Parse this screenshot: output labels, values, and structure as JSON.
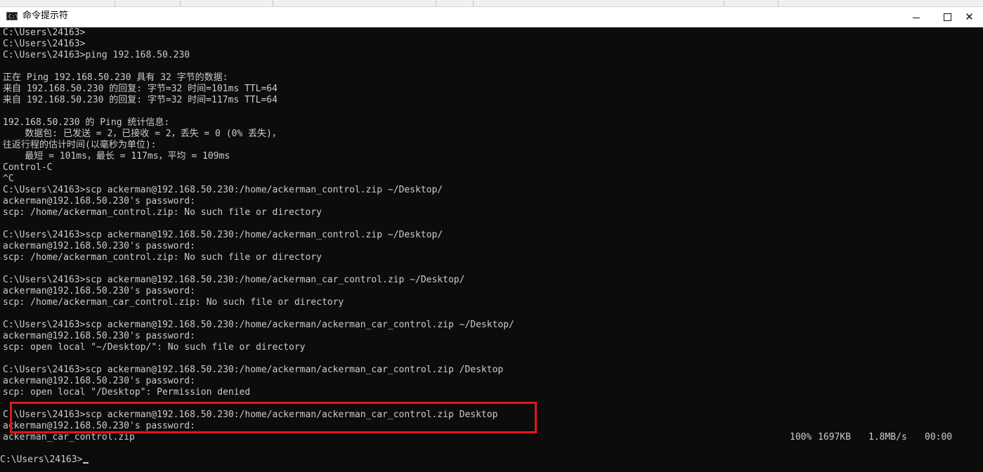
{
  "window": {
    "title": "命令提示符",
    "icon": "cmd-icon",
    "minimize_icon": "minimize-icon",
    "maximize_icon": "maximize-icon",
    "close_icon": "close-icon"
  },
  "terminal": {
    "background": "#0c0c0c",
    "foreground": "#cccccc",
    "lines": [
      "C:\\Users\\24163>",
      "C:\\Users\\24163>",
      "C:\\Users\\24163>ping 192.168.50.230",
      "",
      "正在 Ping 192.168.50.230 具有 32 字节的数据:",
      "来自 192.168.50.230 的回复: 字节=32 时间=101ms TTL=64",
      "来自 192.168.50.230 的回复: 字节=32 时间=117ms TTL=64",
      "",
      "192.168.50.230 的 Ping 统计信息:",
      "    数据包: 已发送 = 2，已接收 = 2，丢失 = 0 (0% 丢失)，",
      "往返行程的估计时间(以毫秒为单位):",
      "    最短 = 101ms，最长 = 117ms，平均 = 109ms",
      "Control-C",
      "^C",
      "C:\\Users\\24163>scp ackerman@192.168.50.230:/home/ackerman_control.zip ~/Desktop/",
      "ackerman@192.168.50.230's password:",
      "scp: /home/ackerman_control.zip: No such file or directory",
      "",
      "C:\\Users\\24163>scp ackerman@192.168.50.230:/home/ackerman_control.zip ~/Desktop/",
      "ackerman@192.168.50.230's password:",
      "scp: /home/ackerman_control.zip: No such file or directory",
      "",
      "C:\\Users\\24163>scp ackerman@192.168.50.230:/home/ackerman_car_control.zip ~/Desktop/",
      "ackerman@192.168.50.230's password:",
      "scp: /home/ackerman_car_control.zip: No such file or directory",
      "",
      "C:\\Users\\24163>scp ackerman@192.168.50.230:/home/ackerman/ackerman_car_control.zip ~/Desktop/",
      "ackerman@192.168.50.230's password:",
      "scp: open local \"~/Desktop/\": No such file or directory",
      "",
      "C:\\Users\\24163>scp ackerman@192.168.50.230:/home/ackerman/ackerman_car_control.zip /Desktop",
      "ackerman@192.168.50.230's password:",
      "scp: open local \"/Desktop\": Permission denied",
      "",
      "C:\\Users\\24163>scp ackerman@192.168.50.230:/home/ackerman/ackerman_car_control.zip Desktop",
      "ackerman@192.168.50.230's password:"
    ],
    "transfer": {
      "filename": "ackerman_car_control.zip",
      "percent": "100%",
      "size": "1697KB",
      "rate": "1.8MB/s",
      "eta": "00:00"
    },
    "prompt": "C:\\Users\\24163>",
    "highlight_color": "#e3151f"
  }
}
